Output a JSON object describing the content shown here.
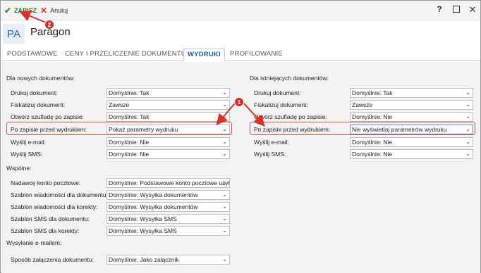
{
  "toolbar": {
    "save_label": "ZAPISZ",
    "cancel_label": "Anuluj",
    "help_glyph": "?",
    "close_glyph": "✕"
  },
  "header": {
    "avatar_text": "PA",
    "title": "Paragon"
  },
  "tabs": [
    {
      "label": "PODSTAWOWE",
      "active": false
    },
    {
      "label": "CENY I PRZELICZENIE DOKUMENTU",
      "active": false
    },
    {
      "label": "WYDRUKI",
      "active": true
    },
    {
      "label": "PROFILOWANIE",
      "active": false
    }
  ],
  "new_docs": {
    "title": "Dla nowych dokumentów:",
    "rows": [
      {
        "label": "Drukuj dokument:",
        "value": "Domyślnie: Tak"
      },
      {
        "label": "Fiskalizuj dokument:",
        "value": "Zawsze"
      },
      {
        "label": "Otwórz szufladę po zapisie:",
        "value": "Domyślnie: Tak"
      },
      {
        "label": "Po zapisie przed wydrukiem:",
        "value": "Pokaż parametry wydruku"
      },
      {
        "label": "Wyślij e-mail:",
        "value": "Domyślnie: Nie"
      },
      {
        "label": "Wyślij SMS:",
        "value": "Domyślnie: Nie"
      }
    ]
  },
  "existing_docs": {
    "title": "Dla istniejących dokumentów:",
    "rows": [
      {
        "label": "Drukuj dokument:",
        "value": "Domyślnie: Tak"
      },
      {
        "label": "Fiskalizuj dokument:",
        "value": "Zawsze"
      },
      {
        "label": "Otwórz szufladę po zapisie:",
        "value": "Domyślnie: Nie"
      },
      {
        "label": "Po zapisie przed wydrukiem:",
        "value": "Nie wyświetlaj parametrów wydruku"
      },
      {
        "label": "Wyślij e-mail:",
        "value": "Domyślnie: Nie"
      },
      {
        "label": "Wyślij SMS:",
        "value": "Domyślnie: Nie"
      }
    ]
  },
  "common": {
    "title": "Wspólne:",
    "rows": [
      {
        "label": "Nadawcę konto pocztowe:",
        "value": "Domyślnie: Podstawowe konto pocztowe użytkownika"
      },
      {
        "label": "Szablon wiadomości dla dokumentu:",
        "value": "Domyślnie: Wysyłka dokumentów"
      },
      {
        "label": "Szablon wiadomości dla korekty:",
        "value": "Domyślnie: Wysyłka dokumentów"
      },
      {
        "label": "Szablon SMS dla dokumentu:",
        "value": "Domyślnie: Wysyłka SMS"
      },
      {
        "label": "Szablon SMS dla korekty:",
        "value": "Domyślnie: Wysyłka SMS"
      }
    ]
  },
  "email_sending": {
    "title": "Wysyłanie e-mailem:",
    "rows": [
      {
        "label": "Sposób załączenia dokumentu:",
        "value": "Domyślnie: Jako załącznik"
      }
    ]
  },
  "annotations": {
    "badge_1": "1",
    "badge_2": "2",
    "color": "#d9302a"
  },
  "colors": {
    "accent": "#1f5fa8",
    "save_green": "#2e9a2e",
    "cancel_red": "#d23a2a"
  }
}
